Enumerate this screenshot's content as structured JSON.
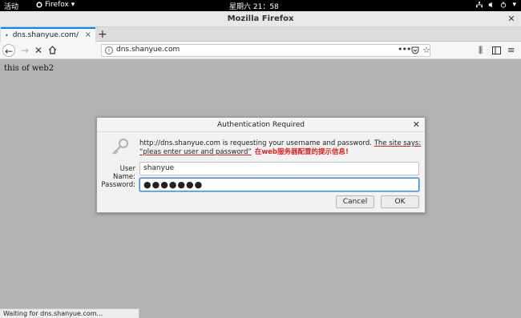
{
  "gnome_bar": {
    "activities_label": "活动",
    "app_label": "Firefox",
    "clock": "星期六 21：58"
  },
  "window": {
    "title": "Mozilla Firefox"
  },
  "tabs": [
    {
      "label": "dns.shanyue.com/"
    }
  ],
  "url_bar": {
    "host": "dns.shanyue.com"
  },
  "page": {
    "body_text": "this of web2"
  },
  "auth_dialog": {
    "title": "Authentication Required",
    "message_prefix": "http://dns.shanyue.com is requesting your username and password. ",
    "message_site_says": "The site says: “pleas enter user and password”",
    "annotation": "在web服务器配置的提示信息!",
    "username_label": "User Name:",
    "username_value": "shanyue",
    "password_label": "Password:",
    "password_value": "●●●●●●●",
    "cancel_label": "Cancel",
    "ok_label": "OK"
  },
  "status_bar": {
    "text": "Waiting for dns.shanyue.com..."
  },
  "colors": {
    "tab_accent": "#0a84ff",
    "annotation_red": "#e02020",
    "focus_blue": "#3d8fe0"
  }
}
